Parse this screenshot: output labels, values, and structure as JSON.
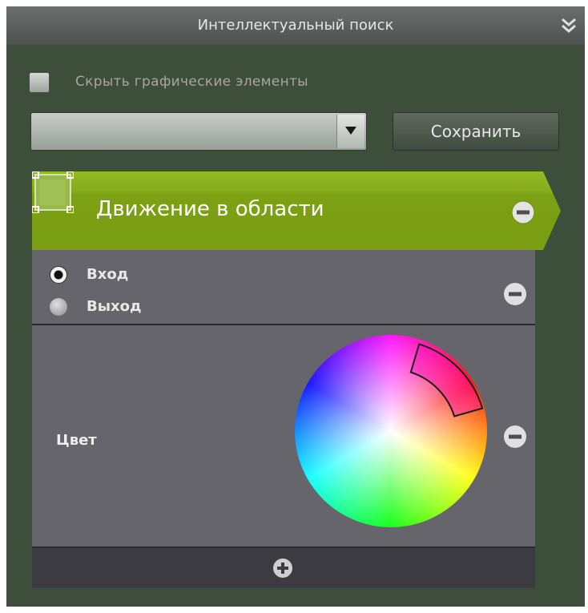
{
  "panel": {
    "title": "Интеллектуальный поиск",
    "collapse_icon": "double-chevron-down-icon"
  },
  "options": {
    "hide_graphics_label": "Скрыть графические элементы",
    "hide_graphics_checked": false
  },
  "preset": {
    "dropdown_value": "",
    "save_label": "Сохранить"
  },
  "filter": {
    "title": "Движение в области",
    "accent_color": "#7fa617",
    "direction": {
      "options": [
        "Вход",
        "Выход"
      ],
      "selected": "Вход"
    },
    "color": {
      "label": "Цвет",
      "selected_hue": "magenta"
    }
  },
  "icons": {
    "remove": "minus-circle-icon",
    "add": "plus-circle-icon",
    "area": "area-selection-icon"
  }
}
